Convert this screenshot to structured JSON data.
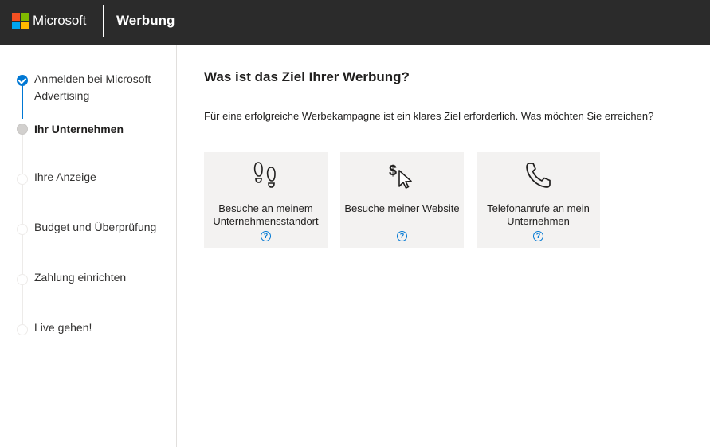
{
  "header": {
    "brand": "Microsoft",
    "app_title": "Werbung",
    "background": "#2b2b2b"
  },
  "sidebar": {
    "steps": [
      {
        "label": "Anmelden bei Microsoft Advertising",
        "state": "done"
      },
      {
        "label": "Ihr Unternehmen",
        "state": "current"
      },
      {
        "label": "Ihre Anzeige",
        "state": "todo"
      },
      {
        "label": "Budget und Überprüfung",
        "state": "todo"
      },
      {
        "label": "Zahlung einrichten",
        "state": "todo"
      },
      {
        "label": "Live gehen!",
        "state": "todo"
      }
    ]
  },
  "main": {
    "title": "Was ist das Ziel Ihrer Werbung?",
    "description": "Für eine erfolgreiche Werbekampagne ist ein klares Ziel erforderlich. Was möchten Sie erreichen?",
    "goals": [
      {
        "label": "Besuche an meinem Unternehmensstandort",
        "icon": "footprints-icon",
        "help": "?"
      },
      {
        "label": "Besuche meiner Website",
        "icon": "dollar-cursor-icon",
        "help": "?"
      },
      {
        "label": "Telefonanrufe an mein Unternehmen",
        "icon": "phone-icon",
        "help": "?"
      }
    ]
  },
  "colors": {
    "accent": "#0078d4",
    "card_background": "#f3f2f1"
  }
}
